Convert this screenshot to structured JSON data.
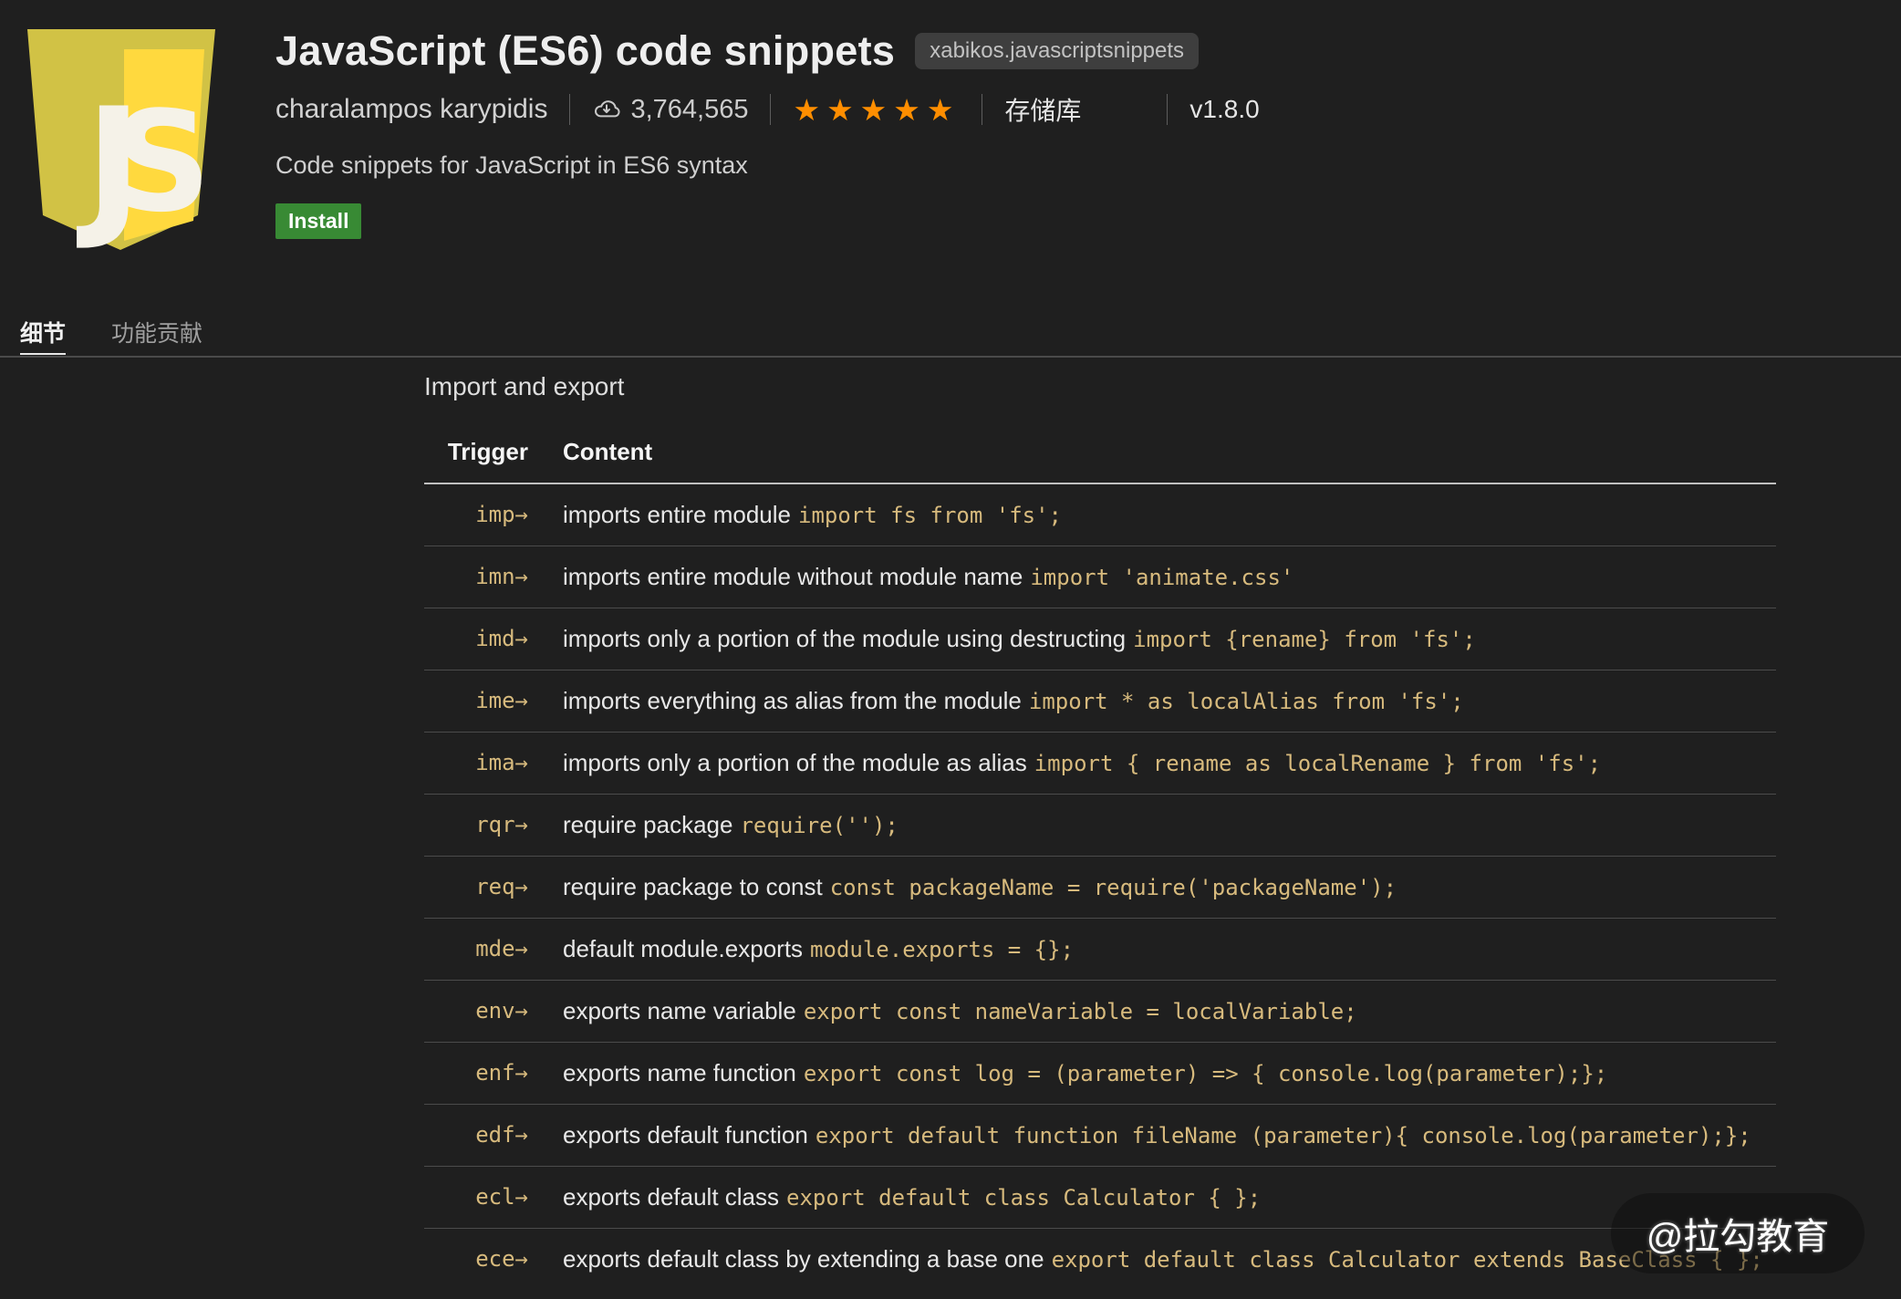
{
  "header": {
    "title": "JavaScript (ES6) code snippets",
    "identifier_badge": "xabikos.javascriptsnippets",
    "author": "charalampos karypidis",
    "downloads": "3,764,565",
    "stars": "★★★★★",
    "repository_label": "存储库",
    "version": "v1.8.0",
    "description": "Code snippets for JavaScript in ES6 syntax",
    "install_label": "Install",
    "logo_letters": {
      "j": "J",
      "s": "S"
    }
  },
  "tabs": [
    {
      "label": "细节",
      "active": true
    },
    {
      "label": "功能贡献",
      "active": false
    }
  ],
  "content": {
    "section_title": "Import and export",
    "table": {
      "headers": [
        "Trigger",
        "Content"
      ],
      "rows": [
        {
          "trigger": "imp→",
          "desc": "imports entire module",
          "code": "import fs from 'fs';"
        },
        {
          "trigger": "imn→",
          "desc": "imports entire module without module name",
          "code": "import 'animate.css'"
        },
        {
          "trigger": "imd→",
          "desc": "imports only a portion of the module using destructing",
          "code": "import {rename} from 'fs';"
        },
        {
          "trigger": "ime→",
          "desc": "imports everything as alias from the module",
          "code": "import * as localAlias from 'fs';"
        },
        {
          "trigger": "ima→",
          "desc": "imports only a portion of the module as alias",
          "code": "import { rename as localRename } from 'fs';"
        },
        {
          "trigger": "rqr→",
          "desc": "require package",
          "code": "require('');"
        },
        {
          "trigger": "req→",
          "desc": "require package to const",
          "code": "const packageName = require('packageName');"
        },
        {
          "trigger": "mde→",
          "desc": "default module.exports",
          "code": "module.exports = {};"
        },
        {
          "trigger": "env→",
          "desc": "exports name variable",
          "code": "export const nameVariable = localVariable;"
        },
        {
          "trigger": "enf→",
          "desc": "exports name function",
          "code": "export const log = (parameter) => { console.log(parameter);};"
        },
        {
          "trigger": "edf→",
          "desc": "exports default function",
          "code": "export default function fileName (parameter){ console.log(parameter);};"
        },
        {
          "trigger": "ecl→",
          "desc": "exports default class",
          "code": "export default class Calculator { };"
        },
        {
          "trigger": "ece→",
          "desc": "exports default class by extending a base one",
          "code": "export default class Calculator extends BaseClass { };"
        }
      ]
    }
  },
  "watermark": "@拉勾教育",
  "colors": {
    "page_background": "#1f1f1f",
    "install_green": "#388a34",
    "star_orange": "#ff8e00",
    "code_tan": "#d7ba7d",
    "logo_yellow_dull": "#d1c245",
    "logo_yellow_bright": "#ffd93e",
    "row_separator": "#4b4b4b",
    "header_rule": "#c0c0c0"
  }
}
